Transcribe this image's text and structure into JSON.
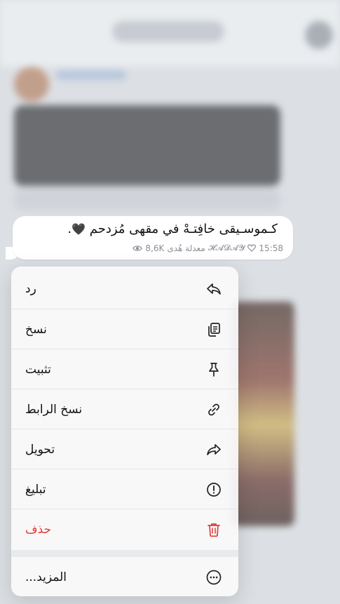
{
  "message": {
    "text": "كـموسـيقى خافِتـهْ  في مقهى مُزدحم",
    "emoji": "🖤",
    "trailing": ".",
    "time": "15:58",
    "author": "𝓗𝓐𝓓𝓐𝓨",
    "channel": "معدلة هُدى",
    "views": "8,6K"
  },
  "menu": {
    "items": [
      {
        "label": "رد",
        "icon": "reply-icon"
      },
      {
        "label": "نسخ",
        "icon": "copy-icon"
      },
      {
        "label": "تثبيت",
        "icon": "pin-icon"
      },
      {
        "label": "نسخ الرابط",
        "icon": "link-icon"
      },
      {
        "label": "تحويل",
        "icon": "forward-icon"
      },
      {
        "label": "تبليغ",
        "icon": "report-icon"
      },
      {
        "label": "حذف",
        "icon": "trash-icon",
        "color": "#e53935"
      },
      {
        "label": "المزيد...",
        "icon": "more-icon"
      }
    ]
  }
}
